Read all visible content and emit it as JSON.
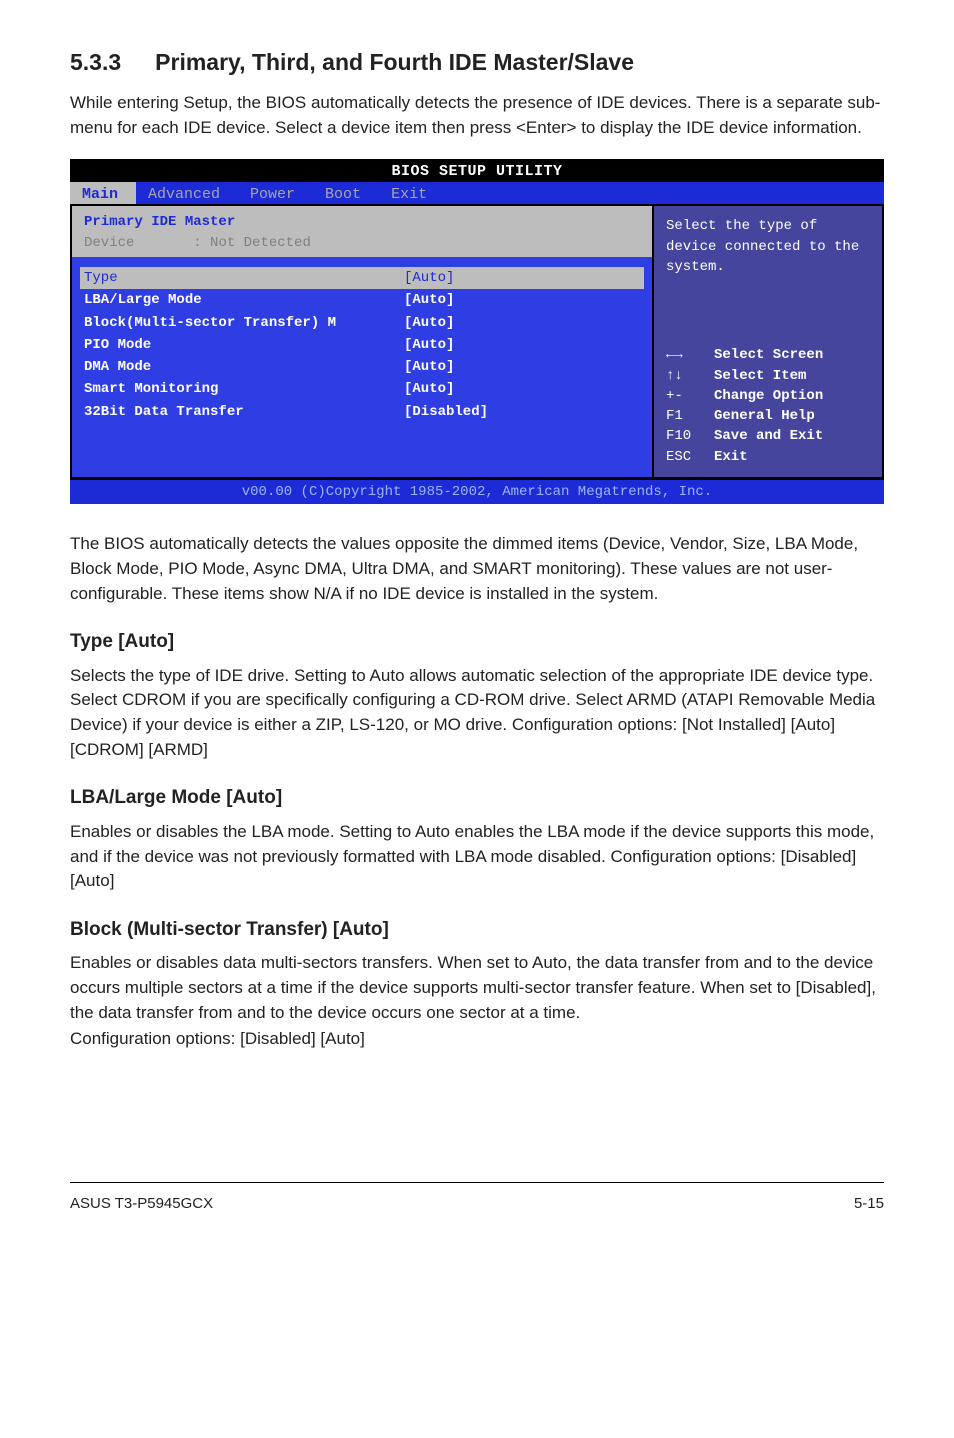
{
  "section": {
    "num": "5.3.3",
    "title": "Primary, Third, and Fourth IDE Master/Slave"
  },
  "intro": "While entering Setup, the BIOS automatically detects the presence of IDE devices. There is a separate sub-menu for each IDE device. Select a device item then press <Enter> to display the IDE device information.",
  "bios": {
    "utility_title": "BIOS SETUP UTILITY",
    "tabs": {
      "main": "Main",
      "advanced": "Advanced",
      "power": "Power",
      "boot": "Boot",
      "exit": "Exit"
    },
    "header_line1": "Primary IDE Master",
    "hdr_dev_label": "Device",
    "hdr_dev_value": ": Not Detected",
    "rows": {
      "type": {
        "label": "Type",
        "value": "[Auto]"
      },
      "lba": {
        "label": "LBA/Large Mode",
        "value": "[Auto]"
      },
      "block": {
        "label": "Block(Multi-sector Transfer) M",
        "value": "[Auto]"
      },
      "pio": {
        "label": "PIO Mode",
        "value": "[Auto]"
      },
      "dma": {
        "label": "DMA Mode",
        "value": "[Auto]"
      },
      "smart": {
        "label": "Smart Monitoring",
        "value": "[Auto]"
      },
      "xfer": {
        "label": "32Bit Data Transfer",
        "value": "[Disabled]"
      }
    },
    "help_text": "Select the type of device connected to the system.",
    "keys": {
      "lr": {
        "k": "←→",
        "d": "Select Screen"
      },
      "ud": {
        "k": "↑↓",
        "d": "Select Item"
      },
      "pm": {
        "k": "+-",
        "d": "Change Option"
      },
      "f1": {
        "k": "F1",
        "d": "General Help"
      },
      "f10": {
        "k": "F10",
        "d": "Save and Exit"
      },
      "esc": {
        "k": "ESC",
        "d": "Exit"
      }
    },
    "footer": "v00.00 (C)Copyright 1985-2002, American Megatrends, Inc."
  },
  "after_bios": "The BIOS automatically detects the values opposite the dimmed items (Device, Vendor, Size, LBA Mode, Block Mode, PIO Mode, Async DMA, Ultra DMA, and SMART monitoring). These values are not user-configurable. These items show N/A if no IDE device is installed in the system.",
  "type": {
    "heading": "Type [Auto]",
    "body": "Selects the type of IDE drive. Setting to Auto allows automatic selection of the appropriate IDE device type. Select CDROM if you are specifically configuring a CD-ROM drive. Select ARMD (ATAPI Removable Media Device) if your device is either a ZIP, LS-120, or MO drive. Configuration options: [Not Installed] [Auto] [CDROM] [ARMD]"
  },
  "lba": {
    "heading": "LBA/Large Mode [Auto]",
    "body": "Enables or disables the LBA mode. Setting to Auto enables the LBA mode if the device supports this mode, and if the device was not previously formatted with LBA mode disabled. Configuration options: [Disabled] [Auto]"
  },
  "block": {
    "heading": "Block (Multi-sector Transfer) [Auto]",
    "body": "Enables or disables data multi-sectors transfers. When set to Auto, the data transfer from and to the device occurs multiple sectors at a time if the device supports multi-sector transfer feature. When set to [Disabled], the data transfer from and to the device occurs one sector at a time.",
    "body2": "Configuration options: [Disabled] [Auto]"
  },
  "footer": {
    "left": "ASUS T3-P5945GCX",
    "right": "5-15"
  }
}
